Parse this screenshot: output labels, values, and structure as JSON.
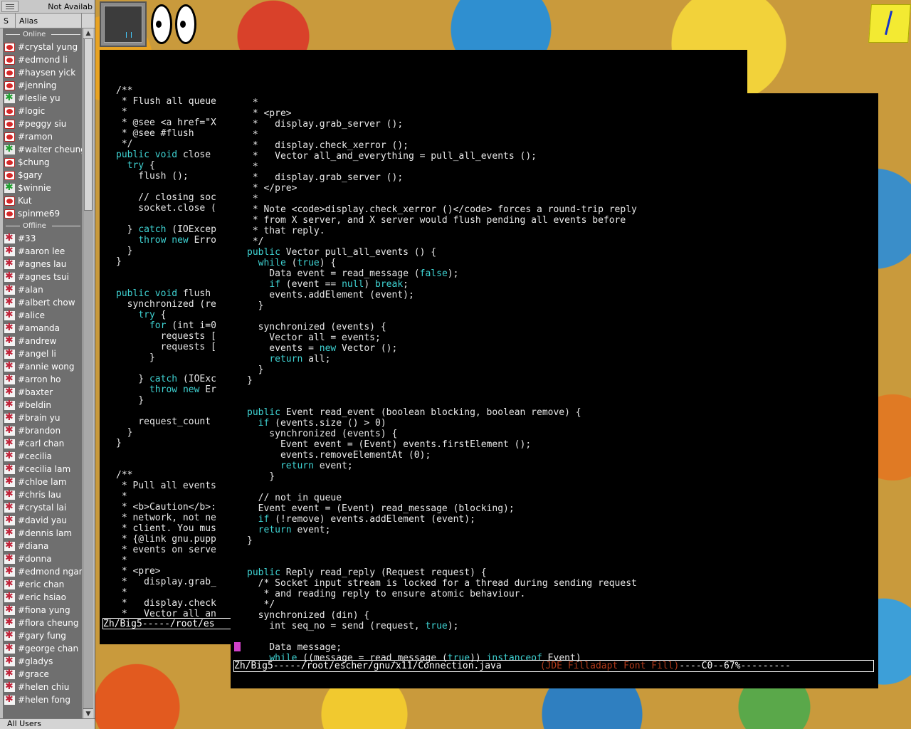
{
  "buddy_list": {
    "status": "Not Availab",
    "col_s": "S",
    "col_alias": "Alias",
    "online_label": "Online",
    "offline_label": "Offline",
    "online": [
      "#crystal yung",
      "#edmond li",
      "#haysen yick",
      "#jenning",
      "#leslie yu",
      "#logic",
      "#peggy siu",
      "#ramon",
      "#walter cheung",
      "$chung",
      "$gary",
      "$winnie",
      "Kut",
      "spinme69"
    ],
    "online_icons": [
      "on",
      "on",
      "on",
      "on",
      "star",
      "on",
      "on",
      "on",
      "star",
      "on",
      "on",
      "star",
      "on",
      "on"
    ],
    "offline": [
      "#33",
      "#aaron lee",
      "#agnes lau",
      "#agnes tsui",
      "#alan",
      "#albert chow",
      "#alice",
      "#amanda",
      "#andrew",
      "#angel li",
      "#annie wong",
      "#arron ho",
      "#baxter",
      "#beldin",
      "#brain yu",
      "#brandon",
      "#carl chan",
      "#cecilia",
      "#cecilia lam",
      "#chloe lam",
      "#chris lau",
      "#crystal lai",
      "#david yau",
      "#dennis lam",
      "#diana",
      "#donna",
      "#edmond ngan",
      "#eric chan",
      "#eric hsiao",
      "#fiona yung",
      "#flora cheung",
      "#gary fung",
      "#george chan",
      "#gladys",
      "#grace",
      "#helen chiu",
      "#helen fong"
    ],
    "bottom": "All Users"
  },
  "emacs_back": {
    "lines": [
      "/**",
      " * Flush all queue",
      " *",
      " * @see <a href=\"X",
      " * @see #flush",
      " */",
      "public void close",
      "  try {",
      "    flush ();",
      "",
      "    // closing soc",
      "    socket.close (",
      "",
      "  } catch (IOExcep",
      "    throw new Erro",
      "  }",
      "}",
      "",
      "",
      "public void flush",
      "  synchronized (re",
      "    try {",
      "      for (int i=0",
      "        requests [",
      "        requests [",
      "      }",
      "",
      "    } catch (IOExc",
      "      throw new Er",
      "    }",
      "",
      "    request_count",
      "  }",
      "}",
      "",
      "",
      "/**",
      " * Pull all events",
      " *",
      " * <b>Caution</b>:",
      " * network, not ne",
      " * client. You mus",
      " * {@link gnu.pupp",
      " * events on serve",
      " *",
      " * <pre>",
      " *   display.grab_",
      " *",
      " *   display.check",
      " *   Vector all_an"
    ],
    "modeline": "Zh/Big5-----/root/es"
  },
  "emacs_front": {
    "lines": [
      " *",
      " * <pre>",
      " *   display.grab_server ();",
      " *",
      " *   display.check_xerror ();",
      " *   Vector all_and_everything = pull_all_events ();",
      " *",
      " *   display.grab_server ();",
      " * </pre>",
      " *",
      " * Note <code>display.check_xerror ()</code> forces a round-trip reply",
      " * from X server, and X server would flush pending all events before",
      " * that reply.",
      " */",
      "public Vector pull_all_events () {",
      "  while (true) {",
      "    Data event = read_message (false);",
      "    if (event == null) break;",
      "    events.addElement (event);",
      "  }",
      "",
      "  synchronized (events) {",
      "    Vector all = events;",
      "    events = new Vector ();",
      "    return all;",
      "  }",
      "}",
      "",
      "",
      "public Event read_event (boolean blocking, boolean remove) {",
      "  if (events.size () > 0)",
      "    synchronized (events) {",
      "      Event event = (Event) events.firstElement ();",
      "      events.removeElementAt (0);",
      "      return event;",
      "    }",
      "",
      "  // not in queue",
      "  Event event = (Event) read_message (blocking);",
      "  if (!remove) events.addElement (event);",
      "  return event;",
      "}",
      "",
      "",
      "public Reply read_reply (Request request) {",
      "  /* Socket input stream is locked for a thread during sending request",
      "   * and reading reply to ensure atomic behaviour.",
      "   */",
      "  synchronized (din) {",
      "    int seq_no = send (request, true);",
      "",
      "    Data message;",
      "    while ((message = read_message (true)) instanceof Event)"
    ],
    "modeline_file": "Zh/Big5-----/root/escher/gnu/x11/Connection.java",
    "modeline_mode": "(JDE Filladapt Font Fill)",
    "modeline_tail": "----C0--67%---------"
  }
}
